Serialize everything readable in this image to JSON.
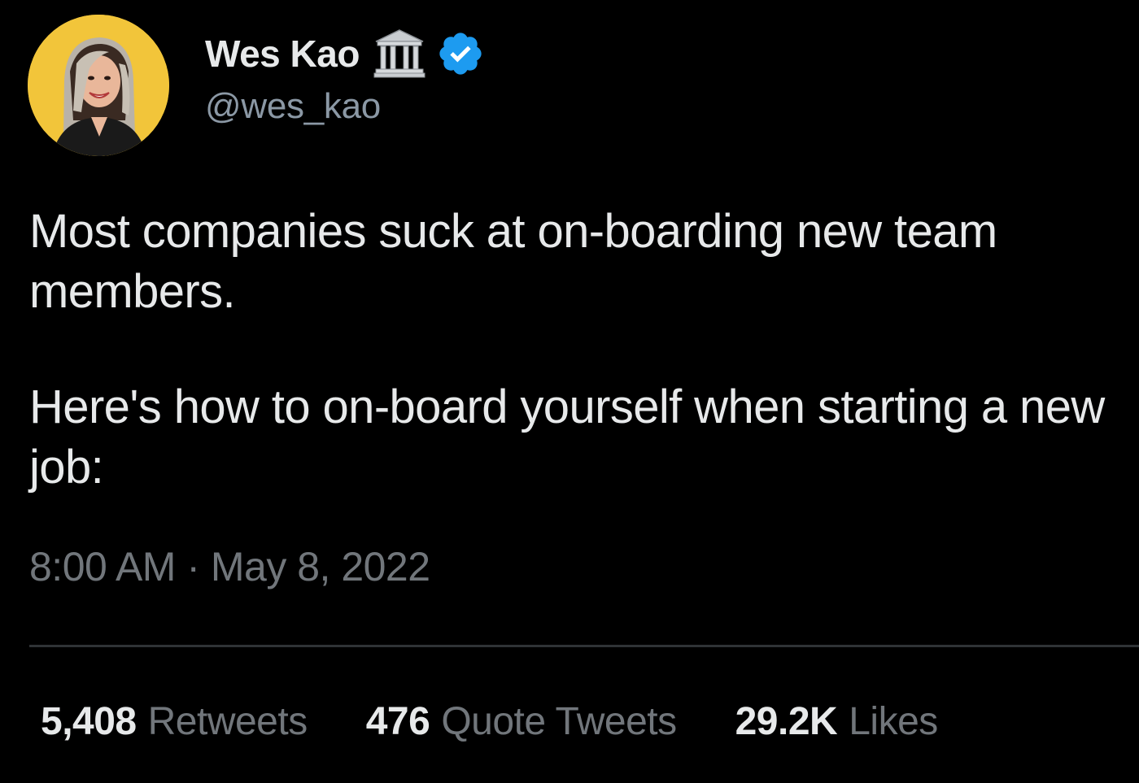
{
  "author": {
    "display_name": "Wes Kao",
    "handle": "@wes_kao",
    "affiliation_icon": "classical-building-icon",
    "verified_icon": "verified-badge-icon",
    "verified_color": "#1d9bf0",
    "avatar_bg_color": "#f2c53a"
  },
  "tweet": {
    "paragraph_1": "Most companies suck at on-boarding new team members.",
    "paragraph_2": "Here's how to on-board yourself when starting a new job:",
    "timestamp": "8:00 AM · May 8, 2022"
  },
  "stats": {
    "retweets": {
      "count": "5,408",
      "label": "Retweets"
    },
    "quote_tweets": {
      "count": "476",
      "label": "Quote Tweets"
    },
    "likes": {
      "count": "29.2K",
      "label": "Likes"
    }
  },
  "colors": {
    "background": "#000000",
    "text_primary": "#e7e9ea",
    "text_secondary": "#71767b",
    "divider": "#2f3336"
  }
}
